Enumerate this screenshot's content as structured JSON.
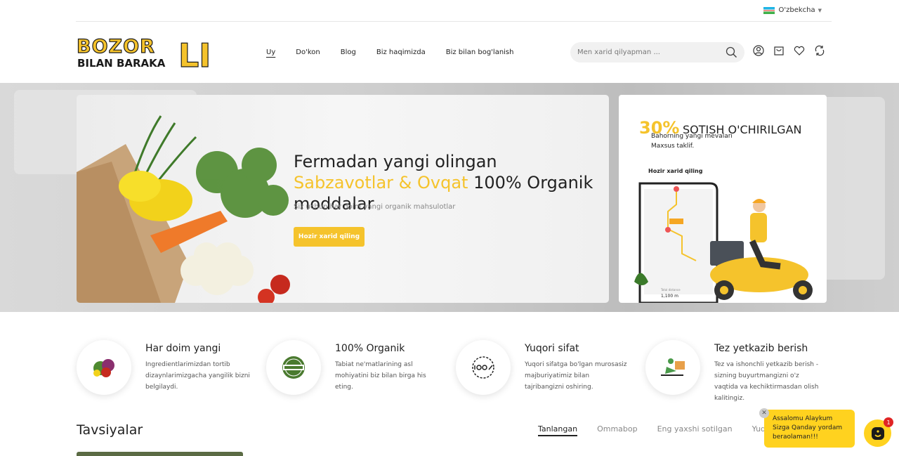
{
  "topbar": {
    "language": "O'zbekcha"
  },
  "logo": {
    "line1": "BOZOR",
    "line2": "BILAN BARAKA",
    "suffix": "LI"
  },
  "nav": {
    "items": [
      "Uy",
      "Do'kon",
      "Blog",
      "Biz haqimizda",
      "Biz bilan bog'lanish"
    ],
    "active": "Uy"
  },
  "search": {
    "placeholder": "Men xarid qilyapman ..."
  },
  "header_icons": [
    "user-icon",
    "cart-icon",
    "heart-icon",
    "compare-icon"
  ],
  "hero": {
    "title_part1": "Fermadan yangi olingan ",
    "title_highlight": "Sabzavotlar & Ovqat",
    "title_part2": " 100% Organik moddalar",
    "subtitle": "Siz uchun har doim yangi organik mahsulotlar",
    "button": "Hozir xarid qiling"
  },
  "promo": {
    "percent": "30%",
    "title": "SOTISH O'CHIRILGAN",
    "subtitle": "Bahorning yangi mevalari Maxsus taklif.",
    "cta": "Hozir xarid qiling",
    "map_distance": "1,100 m",
    "map_label": "Total distance"
  },
  "features": [
    {
      "title": "Har doim yangi",
      "text": "Ingredientlarimizdan tortib dizaynlarimizgacha yangilik bizni belgilaydi.",
      "icon": "vegetables-icon"
    },
    {
      "title": "100% Organik",
      "text": "Tabiat ne'matlarining asl mohiyatini biz bilan birga his eting.",
      "icon": "organic-badge-icon"
    },
    {
      "title": "Yuqori sifat",
      "text": "Yuqori sifatga bo'lgan murosasiz majburiyatimiz bilan tajribangizni oshiring.",
      "icon": "quality-100-icon"
    },
    {
      "title": "Tez yetkazib berish",
      "text": "Tez va ishonchli yetkazib berish - sizning buyurtmangizni o'z vaqtida va kechiktirmasdan olish kalitingiz.",
      "icon": "delivery-icon"
    }
  ],
  "recommendations": {
    "title": "Tavsiyalar",
    "tabs": [
      "Tanlangan",
      "Ommabop",
      "Eng yaxshi sotilgan",
      "Yuqori"
    ],
    "active_tab": "Tanlangan"
  },
  "chat": {
    "message_line1": "Assalomu Alaykum",
    "message_line2": "Sizga Qanday yordam beraolaman!!!",
    "badge_count": "1"
  },
  "colors": {
    "accent": "#f5c32c",
    "chat": "#ffd21f",
    "badge": "#e02424"
  }
}
